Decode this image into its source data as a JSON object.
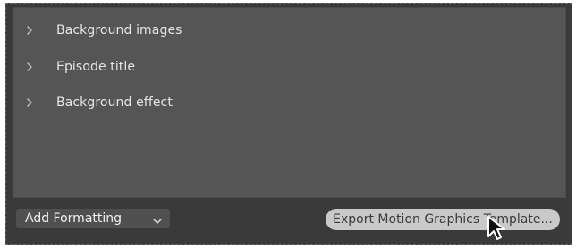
{
  "panel": {
    "items": [
      {
        "label": "Background images",
        "icon": "chevron-right-icon"
      },
      {
        "label": "Episode title",
        "icon": "chevron-right-icon"
      },
      {
        "label": "Background effect",
        "icon": "chevron-right-icon"
      }
    ]
  },
  "bottom": {
    "dropdown": {
      "label": "Add Formatting",
      "icon": "chevron-down-icon"
    },
    "export_button": {
      "label": "Export Motion Graphics Template..."
    }
  },
  "cursor": {
    "icon": "mouse-pointer-icon"
  },
  "colors": {
    "panel_bg": "#555555",
    "outer_bg": "#3a3a3a",
    "text": "#e6e6e6",
    "button_bg": "#c9c9c9",
    "dropdown_bg": "#505050"
  }
}
